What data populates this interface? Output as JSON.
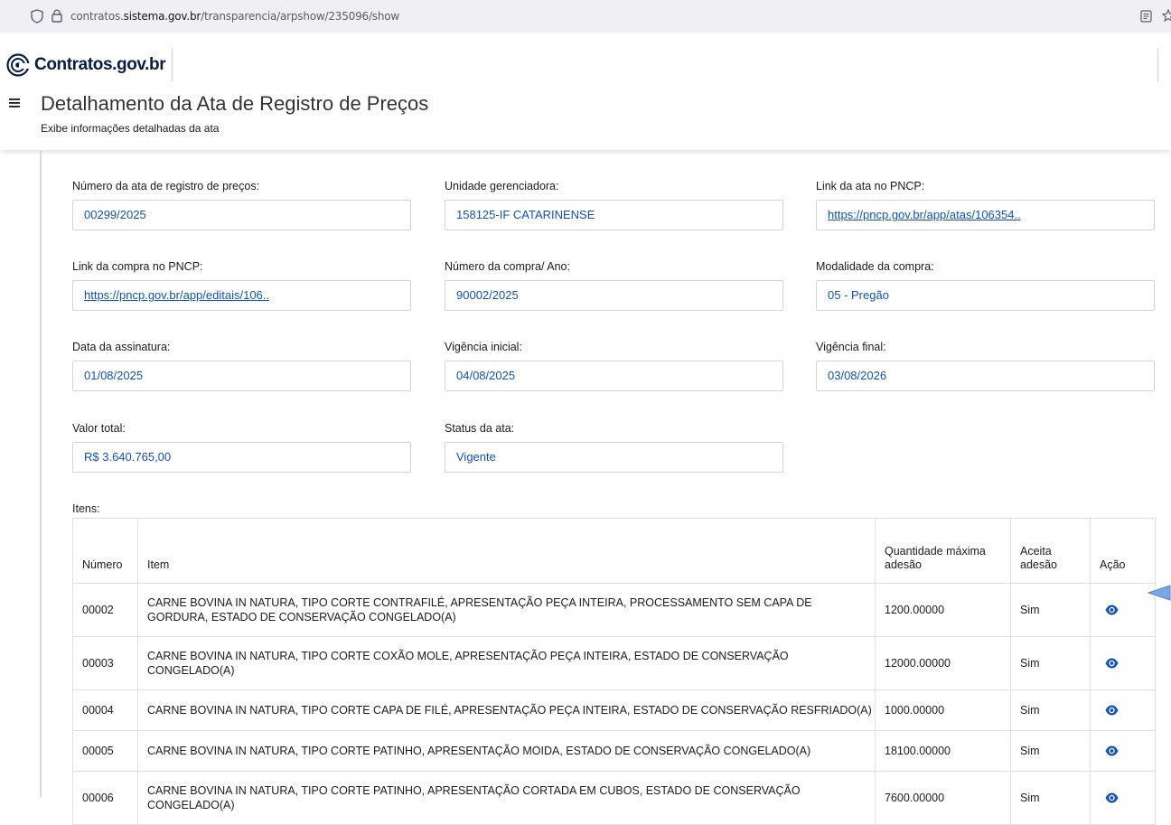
{
  "browser": {
    "url_prefix": "contratos.",
    "url_domain": "sistema.gov.br",
    "url_path": "/transparencia/arpshow/235096/show",
    "icons": [
      "shield-icon",
      "lock-icon",
      "reader-mode-icon",
      "bookmark-star-icon"
    ]
  },
  "header": {
    "brand": "Contratos.gov.br",
    "title": "Detalhamento da Ata de Registro de Preços",
    "subtitle": "Exibe informações detalhadas da ata",
    "icons": [
      "hamburger-menu-icon",
      "contratos-logo-icon"
    ]
  },
  "fields": {
    "numero_ata": {
      "label": "Número da ata de registro de preços:",
      "value": "00299/2025"
    },
    "unidade": {
      "label": "Unidade gerenciadora:",
      "value": "158125-IF CATARINENSE"
    },
    "link_ata": {
      "label": "Link da ata no PNCP:",
      "value": "https://pncp.gov.br/app/atas/106354.."
    },
    "link_compra": {
      "label": "Link da compra no PNCP:",
      "value": "https://pncp.gov.br/app/editais/106.."
    },
    "numero_compra": {
      "label": "Número da compra/ Ano:",
      "value": "90002/2025"
    },
    "modalidade": {
      "label": "Modalidade da compra:",
      "value": "05 - Pregão"
    },
    "data_assinatura": {
      "label": "Data da assinatura:",
      "value": "01/08/2025"
    },
    "vigencia_inicial": {
      "label": "Vigência inicial:",
      "value": "04/08/2025"
    },
    "vigencia_final": {
      "label": "Vigência final:",
      "value": "03/08/2026"
    },
    "valor_total": {
      "label": "Valor total:",
      "value": "R$ 3.640.765,00"
    },
    "status": {
      "label": "Status da ata:",
      "value": "Vigente"
    }
  },
  "items": {
    "label": "Itens:",
    "columns": [
      "Número",
      "Item",
      "Quantidade máxima adesão",
      "Aceita adesão",
      "Ação"
    ],
    "rows": [
      {
        "numero": "00002",
        "item": "CARNE BOVINA IN NATURA, TIPO CORTE CONTRAFILÉ, APRESENTAÇÃO PEÇA INTEIRA, PROCESSAMENTO SEM CAPA DE GORDURA, ESTADO DE CONSERVAÇÃO CONGELADO(A)",
        "quantidade": "1200.00000",
        "aceita": "Sim",
        "acao_icon": "eye-icon"
      },
      {
        "numero": "00003",
        "item": "CARNE BOVINA IN NATURA, TIPO CORTE COXÃO MOLE, APRESENTAÇÃO PEÇA INTEIRA, ESTADO DE CONSERVAÇÃO CONGELADO(A)",
        "quantidade": "12000.00000",
        "aceita": "Sim",
        "acao_icon": "eye-icon"
      },
      {
        "numero": "00004",
        "item": "CARNE BOVINA IN NATURA, TIPO CORTE CAPA DE FILÉ, APRESENTAÇÃO PEÇA INTEIRA, ESTADO DE CONSERVAÇÃO RESFRIADO(A)",
        "quantidade": "1000.00000",
        "aceita": "Sim",
        "acao_icon": "eye-icon"
      },
      {
        "numero": "00005",
        "item": "CARNE BOVINA IN NATURA, TIPO CORTE PATINHO, APRESENTAÇÃO MOIDA, ESTADO DE CONSERVAÇÃO CONGELADO(A)",
        "quantidade": "18100.00000",
        "aceita": "Sim",
        "acao_icon": "eye-icon"
      },
      {
        "numero": "00006",
        "item": "CARNE BOVINA IN NATURA, TIPO CORTE PATINHO, APRESENTAÇÃO CORTADA EM CUBOS, ESTADO DE CONSERVAÇÃO CONGELADO(A)",
        "quantidade": "7600.00000",
        "aceita": "Sim",
        "acao_icon": "eye-icon"
      }
    ]
  },
  "colors": {
    "link": "#1351b4",
    "brand": "#071d41",
    "border": "#d4d4d4",
    "pointer_arrow": "#7aa6e6"
  }
}
